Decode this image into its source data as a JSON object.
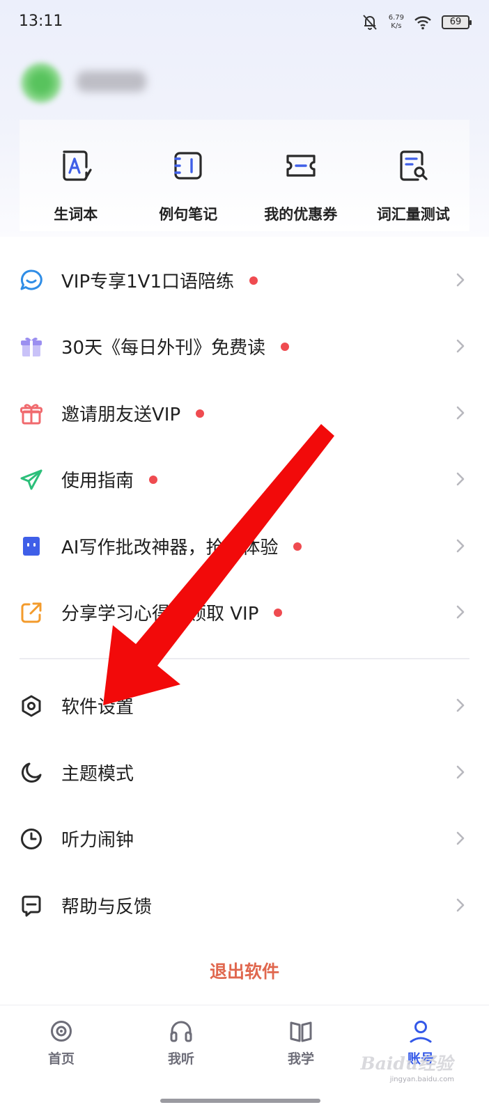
{
  "status_bar": {
    "time": "13:11",
    "net_speed_value": "6.79",
    "net_speed_unit": "K/s",
    "battery": "69"
  },
  "tools": [
    {
      "label": "生词本",
      "icon": "word-book-icon",
      "color": "#3f5fe8"
    },
    {
      "label": "例句笔记",
      "icon": "note-icon",
      "color": "#3f5fe8"
    },
    {
      "label": "我的优惠券",
      "icon": "coupon-icon",
      "color": "#3f5fe8"
    },
    {
      "label": "词汇量测试",
      "icon": "vocab-test-icon",
      "color": "#3f5fe8"
    }
  ],
  "menu": [
    {
      "label": "VIP专享1V1口语陪练",
      "icon": "chat-bubble-icon",
      "color": "#2f8de6",
      "dot": true
    },
    {
      "label": "30天《每日外刊》免费读",
      "icon": "gift-box-icon",
      "color": "#9b8ff0",
      "dot": true
    },
    {
      "label": "邀请朋友送VIP",
      "icon": "gift-icon",
      "color": "#f06a6e",
      "dot": true
    },
    {
      "label": "使用指南",
      "icon": "paper-plane-icon",
      "color": "#2cbf7a",
      "dot": true
    },
    {
      "label": "AI写作批改神器，抢先体验",
      "icon": "robot-icon",
      "color": "#3f5fe8",
      "dot": true
    },
    {
      "label": "分享学习心得，领取 VIP",
      "icon": "share-icon",
      "color": "#f39b2c",
      "dot": true
    },
    {
      "label": "软件设置",
      "icon": "settings-hex-icon",
      "color": "#2a2a2a",
      "dot": false
    },
    {
      "label": "主题模式",
      "icon": "moon-icon",
      "color": "#2a2a2a",
      "dot": false
    },
    {
      "label": "听力闹钟",
      "icon": "clock-icon",
      "color": "#2a2a2a",
      "dot": false
    },
    {
      "label": "帮助与反馈",
      "icon": "feedback-icon",
      "color": "#2a2a2a",
      "dot": false
    }
  ],
  "logout_label": "退出软件",
  "nav": [
    {
      "label": "首页",
      "icon": "home-icon",
      "active": false
    },
    {
      "label": "我听",
      "icon": "headphones-icon",
      "active": false
    },
    {
      "label": "我学",
      "icon": "book-icon",
      "active": false
    },
    {
      "label": "账号",
      "icon": "account-icon",
      "active": true
    }
  ],
  "watermark": "Baidu经验",
  "watermark_sub": "jingyan.baidu.com",
  "annotation_color": "#f20a0a"
}
